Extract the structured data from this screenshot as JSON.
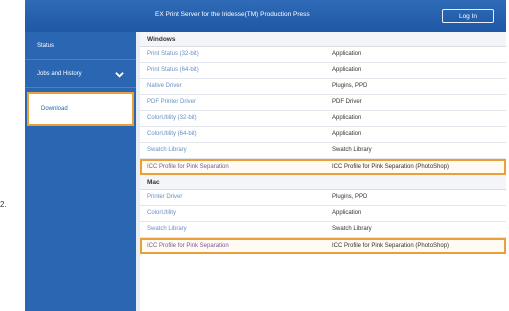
{
  "header": {
    "title": "EX Print Server for the Iridesse(TM) Production Press",
    "login_label": "Log In"
  },
  "sidebar": {
    "items": [
      {
        "label": "Status"
      },
      {
        "label": "Jobs and History"
      },
      {
        "label": "Download"
      }
    ]
  },
  "sections": [
    {
      "title": "Windows",
      "rows": [
        {
          "name": "Print Status (32-bit)",
          "type": "Application"
        },
        {
          "name": "Print Status (64-bit)",
          "type": "Application"
        },
        {
          "name": "Native Driver",
          "type": "Plugins, PPD"
        },
        {
          "name": "PDF Printer Driver",
          "type": "PDF Driver"
        },
        {
          "name": "ColorUtility (32-bit)",
          "type": "Application"
        },
        {
          "name": "ColorUtility (64-bit)",
          "type": "Application"
        },
        {
          "name": "Swatch Library",
          "type": "Swatch Library"
        },
        {
          "name": "ICC Profile for Pink Separation",
          "type": "ICC Profile for Pink Separation (PhotoShop)"
        }
      ]
    },
    {
      "title": "Mac",
      "rows": [
        {
          "name": "Printer Driver",
          "type": "Plugins, PPD"
        },
        {
          "name": "ColorUtility",
          "type": "Application"
        },
        {
          "name": "Swatch Library",
          "type": "Swatch Library"
        },
        {
          "name": "ICC Profile for Pink Separation",
          "type": "ICC Profile for Pink Separation (PhotoShop)"
        }
      ]
    }
  ],
  "note": "2."
}
